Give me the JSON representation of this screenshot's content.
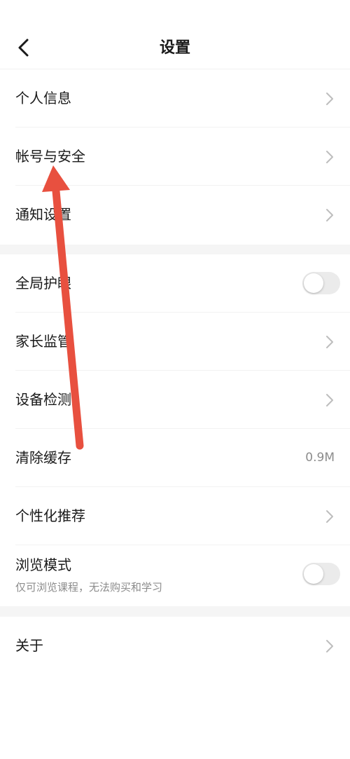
{
  "header": {
    "title": "设置"
  },
  "groups": [
    {
      "items": [
        {
          "label": "个人信息",
          "type": "link"
        },
        {
          "label": "帐号与安全",
          "type": "link"
        },
        {
          "label": "通知设置",
          "type": "link"
        }
      ]
    },
    {
      "items": [
        {
          "label": "全局护眼",
          "type": "toggle",
          "on": false
        },
        {
          "label": "家长监管",
          "type": "link"
        },
        {
          "label": "设备检测",
          "type": "link"
        },
        {
          "label": "清除缓存",
          "type": "value",
          "value": "0.9M"
        },
        {
          "label": "个性化推荐",
          "type": "link"
        },
        {
          "label": "浏览模式",
          "type": "toggle",
          "on": false,
          "subtitle": "仅可浏览课程，无法购买和学习"
        }
      ]
    },
    {
      "items": [
        {
          "label": "关于",
          "type": "link"
        }
      ]
    }
  ],
  "colors": {
    "annotation_arrow": "#e8503f",
    "section_gap": "#f5f5f5",
    "toggle_off": "#ebebeb"
  }
}
